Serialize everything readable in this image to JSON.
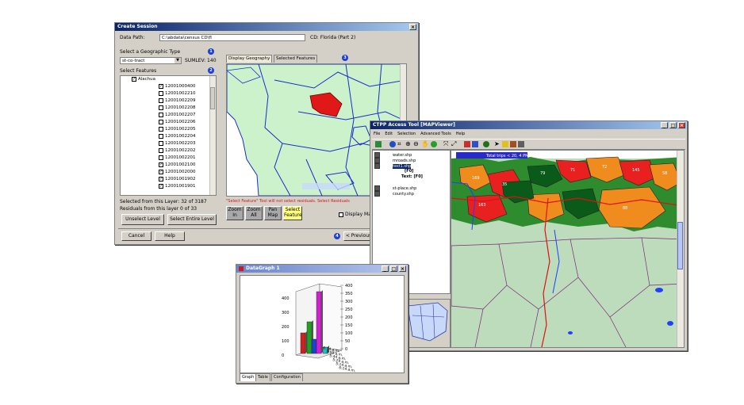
{
  "session": {
    "title": "Create Session",
    "data_path_label": "Data Path:",
    "data_path_value": "C:\\abdata\\census CD\\fl",
    "cd_label": "CD: Florida (Part 2)",
    "geo_type_label": "Select a Geographic Type",
    "geo_type_value": "st-co-tract",
    "sumlev": "SUMLEV: 140",
    "select_features_label": "Select Features",
    "tree_root": "Alachua",
    "tree_items": [
      {
        "code": "12001000400",
        "checked": true
      },
      {
        "code": "12001002210",
        "checked": false
      },
      {
        "code": "12001002209",
        "checked": false
      },
      {
        "code": "12001002208",
        "checked": false
      },
      {
        "code": "12001002207",
        "checked": false
      },
      {
        "code": "12001002206",
        "checked": false
      },
      {
        "code": "12001002205",
        "checked": false
      },
      {
        "code": "12001002204",
        "checked": false
      },
      {
        "code": "12001002203",
        "checked": false
      },
      {
        "code": "12001002202",
        "checked": false
      },
      {
        "code": "12001002201",
        "checked": false
      },
      {
        "code": "12001002100",
        "checked": true
      },
      {
        "code": "12001002000",
        "checked": true
      },
      {
        "code": "12001001902",
        "checked": true
      },
      {
        "code": "12001001901",
        "checked": true
      }
    ],
    "selected_count": "Selected from this Layer: 32 of 3187",
    "residuals_count": "Residuals from this layer 0 of 33",
    "unselect_level": "Unselect Level",
    "select_entire_level": "Select Entire Level",
    "cancel": "Cancel",
    "help": "Help",
    "previous": "< Previous",
    "tab_display": "Display Geography",
    "tab_selected": "Selected Features",
    "warning": "\"Select Feature\" Tool will not select residuals.",
    "warning2": "Select Residuals",
    "zoom_in": "Zoom In",
    "zoom_all": "Zoom All",
    "pan_map": "Pan Map",
    "select_feature": "Select Feature",
    "display_map_label": "Display Ma",
    "badges": [
      "1",
      "2",
      "3",
      "4"
    ]
  },
  "mapviewer": {
    "title": "CTPP Access Tool [MAPViewer]",
    "menu": [
      "File",
      "Edit",
      "Selection",
      "Advanced Tools",
      "Help"
    ],
    "layers": [
      {
        "name": "water.shp",
        "checked": true
      },
      {
        "name": "mroads.shp",
        "checked": true
      },
      {
        "name": "test1.shp",
        "checked": true,
        "selected": true
      },
      {
        "name": "st-place.shp",
        "checked": true
      },
      {
        "name": "county.shp",
        "checked": true
      }
    ],
    "legend_items": [
      "[F0]",
      "Text: [F0]"
    ],
    "legend_banner": "Total trips < 20, 4 PM/rv",
    "zone_labels": [
      "169",
      "35",
      "79",
      "71",
      "72",
      "145",
      "58",
      "88",
      "163"
    ],
    "colors": {
      "red": "#e82020",
      "orange": "#f08c1e",
      "green": "#2e8b2e",
      "darkgreen": "#0a5a1a",
      "water": "#b4d8b4"
    }
  },
  "datagraph": {
    "title": "DataGraph 1",
    "tabs": [
      "Graph",
      "Table",
      "Configuration"
    ],
    "left_ticks": [
      "400",
      "300",
      "200",
      "100",
      "0"
    ],
    "right_ticks": [
      "400",
      "350",
      "300",
      "250",
      "200",
      "150",
      "100",
      "50",
      "0"
    ],
    "row_labels": [
      "6:14 a.m.",
      "5:59 a.m.",
      "5:44 a.m.",
      "5:29 a.m.",
      "5:14 a.m.",
      "6:14 a.m."
    ]
  }
}
